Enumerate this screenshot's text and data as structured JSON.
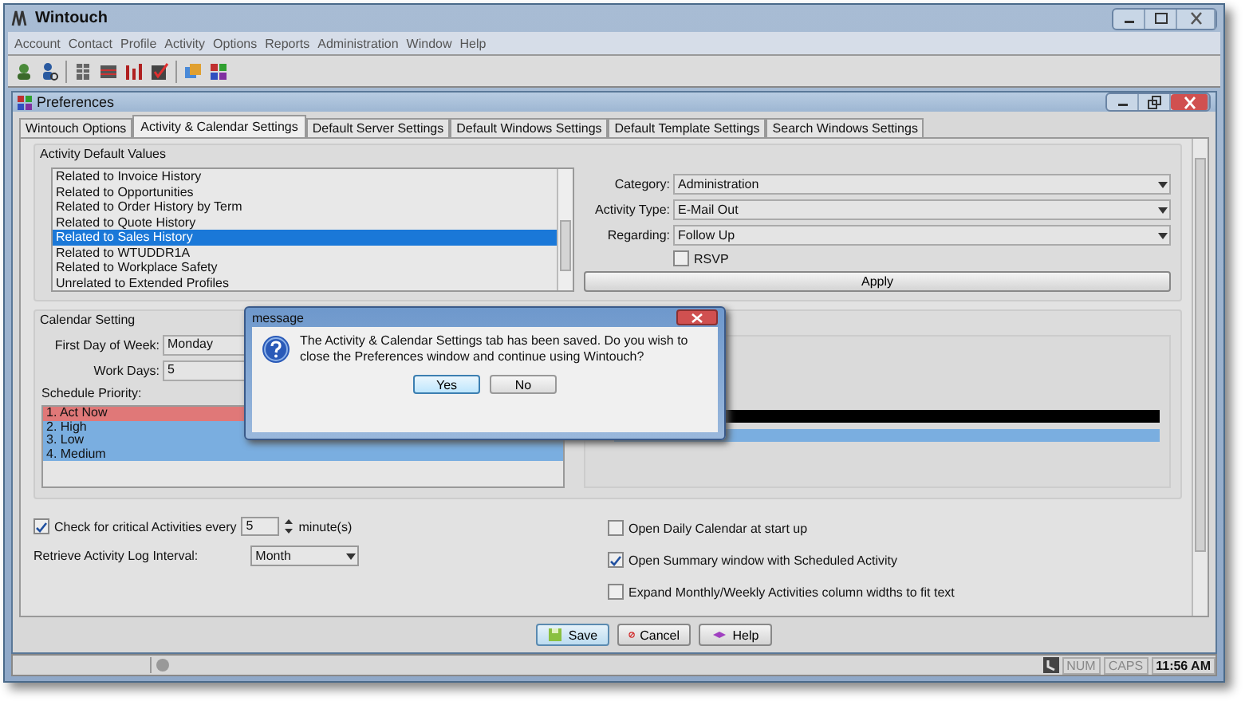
{
  "window": {
    "title": "Wintouch"
  },
  "menu": [
    "Account",
    "Contact",
    "Profile",
    "Activity",
    "Options",
    "Reports",
    "Administration",
    "Window",
    "Help"
  ],
  "preferences": {
    "title": "Preferences",
    "tabs": [
      {
        "label": "Wintouch Options",
        "selected": false
      },
      {
        "label": "Activity & Calendar Settings",
        "selected": true
      },
      {
        "label": "Default Server Settings",
        "selected": false
      },
      {
        "label": "Default Windows Settings",
        "selected": false
      },
      {
        "label": "Default Template Settings",
        "selected": false
      },
      {
        "label": "Search Windows Settings",
        "selected": false
      }
    ],
    "activity_defaults": {
      "title": "Activity Default Values",
      "items": [
        {
          "label": "Related to Invoice History",
          "selected": false
        },
        {
          "label": "Related to Opportunities",
          "selected": false
        },
        {
          "label": "Related to Order History by Term",
          "selected": false
        },
        {
          "label": "Related to Quote History",
          "selected": false
        },
        {
          "label": "Related to Sales History",
          "selected": true
        },
        {
          "label": "Related to WTUDDR1A",
          "selected": false
        },
        {
          "label": "Related to Workplace Safety",
          "selected": false
        },
        {
          "label": "Unrelated to Extended Profiles",
          "selected": false
        }
      ],
      "fields": [
        {
          "label": "Category:",
          "value": "Administration"
        },
        {
          "label": "Activity Type:",
          "value": "E-Mail Out"
        },
        {
          "label": "Regarding:",
          "value": "Follow Up"
        }
      ],
      "rsvp": {
        "label": "RSVP",
        "checked": false
      },
      "apply": "Apply"
    },
    "calendar": {
      "title": "Calendar Setting",
      "fields": [
        {
          "label": "First Day of Week:",
          "value": "Monday"
        },
        {
          "label": "Work Days:",
          "value": "5"
        }
      ],
      "priority_label": "Schedule Priority:",
      "priorities": [
        {
          "label": "1. Act Now",
          "color": "#e07878"
        },
        {
          "label": "2. High",
          "color": "#7aaee0"
        },
        {
          "label": "3. Low",
          "color": "#7aaee0"
        },
        {
          "label": "4. Medium",
          "color": "#7aaee0"
        }
      ]
    },
    "critical": {
      "label": "Check for critical Activities every",
      "checked": true,
      "value": "5",
      "unit": "minute(s)"
    },
    "retrieve": {
      "label": "Retrieve Activity Log Interval:",
      "value": "Month"
    },
    "options": [
      {
        "label": "Open Daily Calendar at start up",
        "checked": false
      },
      {
        "label": "Open Summary window with Scheduled Activity",
        "checked": true
      },
      {
        "label": "Expand Monthly/Weekly Activities column widths to fit text",
        "checked": false
      }
    ],
    "buttons": [
      {
        "kind": "save",
        "label": "Save"
      },
      {
        "kind": "cancel",
        "label": "Cancel"
      },
      {
        "kind": "help",
        "label": "Help"
      }
    ]
  },
  "status_bar": {
    "indicators": [
      "NUM",
      "CAPS"
    ],
    "time": "11:56 AM"
  },
  "dialog": {
    "title": "message",
    "text": "The Activity & Calendar Settings tab has been saved. Do you wish to close the Preferences window and continue using Wintouch?",
    "buttons": [
      {
        "label": "Yes",
        "focused": true
      },
      {
        "label": "No",
        "focused": false
      }
    ]
  }
}
